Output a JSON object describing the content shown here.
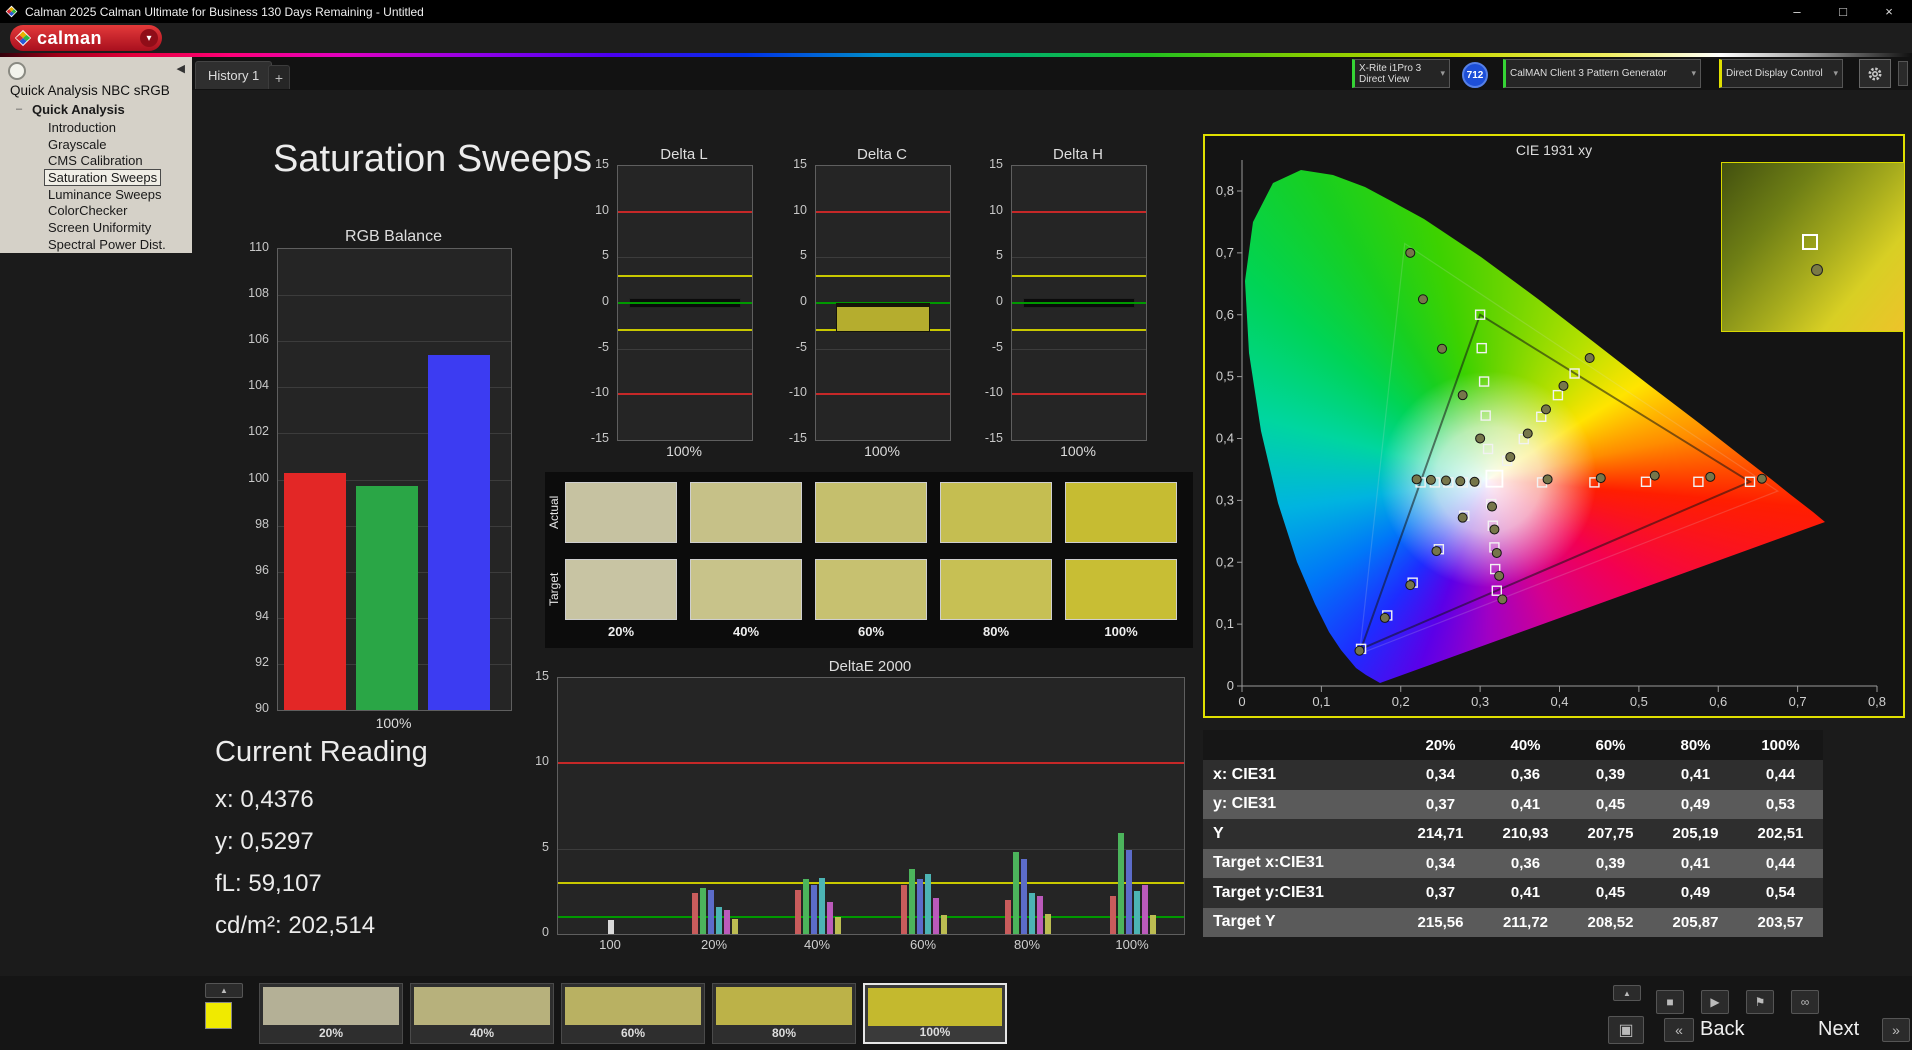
{
  "window": {
    "title": "Calman 2025 Calman Ultimate for Business 130 Days Remaining  - Untitled"
  },
  "icons": {
    "dropdown": "▾",
    "collapse_left": "◀",
    "tree_expander": "–",
    "minimize": "–",
    "maximize": "□",
    "close": "×",
    "up_arrow": "▲",
    "stop": "■",
    "play": "▶",
    "flag": "⚑",
    "link": "∞",
    "layout": "▣",
    "back_chevrons": "«",
    "next_chevrons": "»"
  },
  "brand": {
    "logo_text": "calman"
  },
  "tabs": {
    "history": "History 1",
    "add_tab": "+"
  },
  "hardware": {
    "meter_line1": "X-Rite i1Pro 3",
    "meter_line2": "Direct View",
    "meter_badge": "712",
    "pattern_generator": "CalMAN Client 3 Pattern Generator",
    "display_control": "Direct Display Control"
  },
  "sidebar": {
    "title": "Quick Analysis NBC sRGB",
    "root_item": "Quick Analysis",
    "items": [
      "Introduction",
      "Grayscale",
      "CMS Calibration",
      "Saturation Sweeps",
      "Luminance Sweeps",
      "ColorChecker",
      "Screen Uniformity",
      "Spectral Power Dist."
    ],
    "selected_item": "Saturation Sweeps"
  },
  "page": {
    "title": "Saturation Sweeps"
  },
  "current_reading": {
    "title": "Current Reading",
    "x": "x: 0,4376",
    "y": "y: 0,5297",
    "fl": "fL: 59,107",
    "cdm2": "cd/m²: 202,514"
  },
  "patches": {
    "row_labels": [
      "Actual",
      "Target"
    ],
    "col_labels": [
      "20%",
      "40%",
      "60%",
      "80%",
      "100%"
    ],
    "actual_colors": [
      "#c6c2a1",
      "#c6c188",
      "#c5bf6d",
      "#c5be51",
      "#c6bc32"
    ],
    "target_colors": [
      "#c8c4a3",
      "#c8c38a",
      "#c7c170",
      "#c7c054",
      "#c8be34"
    ]
  },
  "chart_data": [
    {
      "id": "rgb_balance",
      "type": "bar",
      "title": "RGB Balance",
      "categories": [
        "Red",
        "Green",
        "Blue"
      ],
      "values": [
        100.3,
        99.7,
        105.4
      ],
      "colors": [
        "#e32726",
        "#2aa646",
        "#3c3cf2"
      ],
      "ylim": [
        90,
        110
      ],
      "yticks": [
        110,
        108,
        106,
        104,
        102,
        100,
        98,
        96,
        94,
        92,
        90
      ],
      "xlabel": "100%"
    },
    {
      "id": "delta_l",
      "type": "bar",
      "title": "Delta L",
      "value": -0.4,
      "bar_color": "#0a0a0a",
      "ylim": [
        -15,
        15
      ],
      "yticks": [
        15,
        10,
        5,
        0,
        -5,
        -10,
        -15
      ],
      "xlabel": "100%",
      "limits": {
        "red": [
          10,
          -10
        ],
        "yellow": [
          3,
          -3
        ],
        "green": 0
      }
    },
    {
      "id": "delta_c",
      "type": "bar",
      "title": "Delta C",
      "value": -3.2,
      "bar_color": "#b5ad2e",
      "ylim": [
        -15,
        15
      ],
      "yticks": [
        15,
        10,
        5,
        0,
        -5,
        -10,
        -15
      ],
      "xlabel": "100%",
      "limits": {
        "red": [
          10,
          -10
        ],
        "yellow": [
          3,
          -3
        ],
        "green": 0
      }
    },
    {
      "id": "delta_h",
      "type": "bar",
      "title": "Delta H",
      "value": -0.4,
      "bar_color": "#0a0a0a",
      "ylim": [
        -15,
        15
      ],
      "yticks": [
        15,
        10,
        5,
        0,
        -5,
        -10,
        -15
      ],
      "xlabel": "100%",
      "limits": {
        "red": [
          10,
          -10
        ],
        "yellow": [
          3,
          -3
        ],
        "green": 0
      }
    },
    {
      "id": "deltae2000",
      "type": "bar",
      "title": "DeltaE 2000",
      "categories": [
        "100",
        "20%",
        "40%",
        "60%",
        "80%",
        "100%"
      ],
      "single_color": "#d9d9d9",
      "series_colors": [
        "#c95c5c",
        "#4cb45c",
        "#5c6cc9",
        "#4cb4b4",
        "#bb5abb",
        "#bcbc52"
      ],
      "groups": [
        [
          0.8
        ],
        [
          2.4,
          2.7,
          2.6,
          1.6,
          1.4,
          0.9
        ],
        [
          2.6,
          3.2,
          2.9,
          3.3,
          1.9,
          1.0
        ],
        [
          2.9,
          3.8,
          3.2,
          3.5,
          2.1,
          1.1
        ],
        [
          2.0,
          4.8,
          4.4,
          2.4,
          2.2,
          1.2
        ],
        [
          2.2,
          5.9,
          4.9,
          2.5,
          2.9,
          1.1
        ]
      ],
      "ylim": [
        0,
        15
      ],
      "yticks": [
        15,
        10,
        5,
        0
      ],
      "limits": {
        "red": 10,
        "yellow": 3,
        "green": 1
      }
    },
    {
      "id": "cie1931",
      "type": "scatter",
      "title": "CIE 1931 xy",
      "xlim": [
        0,
        0.8
      ],
      "ylim": [
        0,
        0.85
      ],
      "xtick_labels": [
        "0",
        "0,1",
        "0,2",
        "0,3",
        "0,4",
        "0,5",
        "0,6",
        "0,7",
        "0,8"
      ],
      "ytick_labels": [
        "0",
        "0,1",
        "0,2",
        "0,3",
        "0,4",
        "0,5",
        "0,6",
        "0,7",
        "0,8"
      ],
      "srgb_triangle": [
        [
          0.64,
          0.33
        ],
        [
          0.3,
          0.6
        ],
        [
          0.15,
          0.06
        ]
      ],
      "native_triangle": [
        [
          0.675,
          0.315
        ],
        [
          0.205,
          0.715
        ],
        [
          0.148,
          0.052
        ]
      ],
      "targets": [
        [
          0.378,
          0.329
        ],
        [
          0.444,
          0.329
        ],
        [
          0.509,
          0.33
        ],
        [
          0.575,
          0.33
        ],
        [
          0.64,
          0.33
        ],
        [
          0.31,
          0.383
        ],
        [
          0.307,
          0.437
        ],
        [
          0.305,
          0.492
        ],
        [
          0.302,
          0.546
        ],
        [
          0.3,
          0.6
        ],
        [
          0.28,
          0.275
        ],
        [
          0.248,
          0.221
        ],
        [
          0.215,
          0.167
        ],
        [
          0.183,
          0.114
        ],
        [
          0.15,
          0.06
        ],
        [
          0.334,
          0.364
        ],
        [
          0.355,
          0.399
        ],
        [
          0.377,
          0.435
        ],
        [
          0.398,
          0.47
        ],
        [
          0.419,
          0.505
        ],
        [
          0.295,
          0.329
        ],
        [
          0.278,
          0.329
        ],
        [
          0.26,
          0.329
        ],
        [
          0.243,
          0.329
        ],
        [
          0.225,
          0.329
        ],
        [
          0.314,
          0.294
        ],
        [
          0.316,
          0.259
        ],
        [
          0.318,
          0.224
        ],
        [
          0.319,
          0.189
        ],
        [
          0.321,
          0.154
        ]
      ],
      "measurements": [
        [
          0.385,
          0.334
        ],
        [
          0.452,
          0.336
        ],
        [
          0.52,
          0.34
        ],
        [
          0.59,
          0.338
        ],
        [
          0.655,
          0.335
        ],
        [
          0.3,
          0.4
        ],
        [
          0.278,
          0.47
        ],
        [
          0.252,
          0.545
        ],
        [
          0.228,
          0.625
        ],
        [
          0.212,
          0.7
        ],
        [
          0.278,
          0.272
        ],
        [
          0.245,
          0.218
        ],
        [
          0.212,
          0.163
        ],
        [
          0.18,
          0.11
        ],
        [
          0.148,
          0.057
        ],
        [
          0.338,
          0.37
        ],
        [
          0.36,
          0.408
        ],
        [
          0.383,
          0.447
        ],
        [
          0.405,
          0.485
        ],
        [
          0.438,
          0.53
        ],
        [
          0.293,
          0.33
        ],
        [
          0.275,
          0.331
        ],
        [
          0.257,
          0.332
        ],
        [
          0.238,
          0.333
        ],
        [
          0.22,
          0.334
        ],
        [
          0.315,
          0.29
        ],
        [
          0.318,
          0.253
        ],
        [
          0.321,
          0.215
        ],
        [
          0.324,
          0.178
        ],
        [
          0.328,
          0.14
        ]
      ],
      "highlight": [
        0.318,
        0.335
      ]
    },
    {
      "id": "results_table",
      "type": "table",
      "headers": [
        "20%",
        "40%",
        "60%",
        "80%",
        "100%"
      ],
      "rows": [
        {
          "label": "x: CIE31",
          "values": [
            "0,34",
            "0,36",
            "0,39",
            "0,41",
            "0,44"
          ]
        },
        {
          "label": "y: CIE31",
          "values": [
            "0,37",
            "0,41",
            "0,45",
            "0,49",
            "0,53"
          ]
        },
        {
          "label": "Y",
          "values": [
            "214,71",
            "210,93",
            "207,75",
            "205,19",
            "202,51"
          ]
        },
        {
          "label": "Target x:CIE31",
          "values": [
            "0,34",
            "0,36",
            "0,39",
            "0,41",
            "0,44"
          ]
        },
        {
          "label": "Target y:CIE31",
          "values": [
            "0,37",
            "0,41",
            "0,45",
            "0,49",
            "0,54"
          ]
        },
        {
          "label": "Target Y",
          "values": [
            "215,56",
            "211,72",
            "208,52",
            "205,87",
            "203,57"
          ]
        }
      ]
    }
  ],
  "bottom_bar": {
    "preview_color": "#f0ea00",
    "patterns": [
      {
        "label": "20%",
        "color": "#b4b096",
        "selected": false
      },
      {
        "label": "40%",
        "color": "#b7b17c",
        "selected": false
      },
      {
        "label": "60%",
        "color": "#b9b162",
        "selected": false
      },
      {
        "label": "80%",
        "color": "#bcb248",
        "selected": false
      },
      {
        "label": "100%",
        "color": "#c4b92e",
        "selected": true
      }
    ],
    "back_label": "Back",
    "next_label": "Next"
  }
}
